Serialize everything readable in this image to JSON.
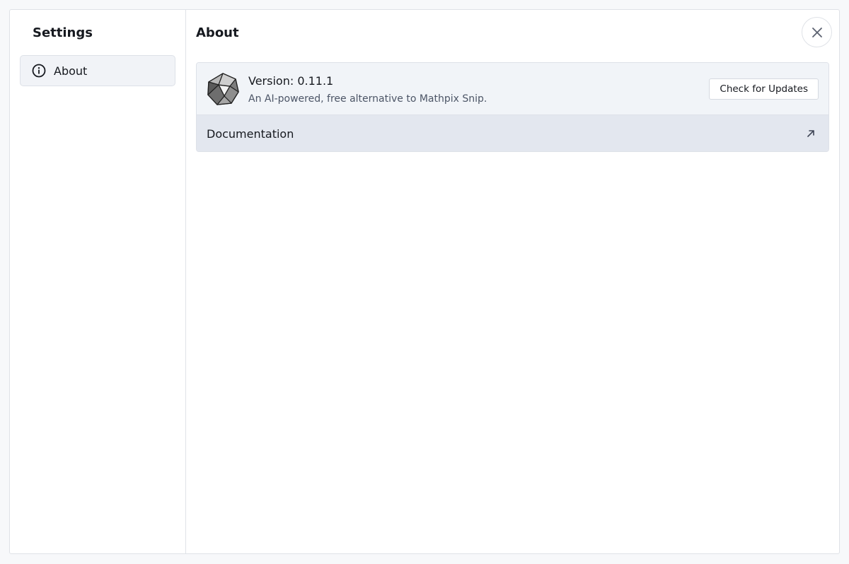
{
  "sidebar": {
    "title": "Settings",
    "items": [
      {
        "label": "About",
        "icon": "info-icon",
        "active": true
      }
    ]
  },
  "main": {
    "title": "About",
    "close_icon": "close-icon",
    "app": {
      "logo_icon": "polyhedron-logo",
      "version": "Version: 0.11.1",
      "tagline": "An AI-powered, free alternative to Mathpix Snip.",
      "update_button": "Check for Updates"
    },
    "links": [
      {
        "label": "Documentation",
        "icon": "external-link-icon"
      }
    ]
  },
  "colors": {
    "background": "#f7f8fa",
    "panel": "#ffffff",
    "card_header": "#f1f4f8",
    "card_link": "#e3e7ef",
    "border": "#dfe2e7",
    "text": "#16191f",
    "muted_text": "#4c5566"
  }
}
